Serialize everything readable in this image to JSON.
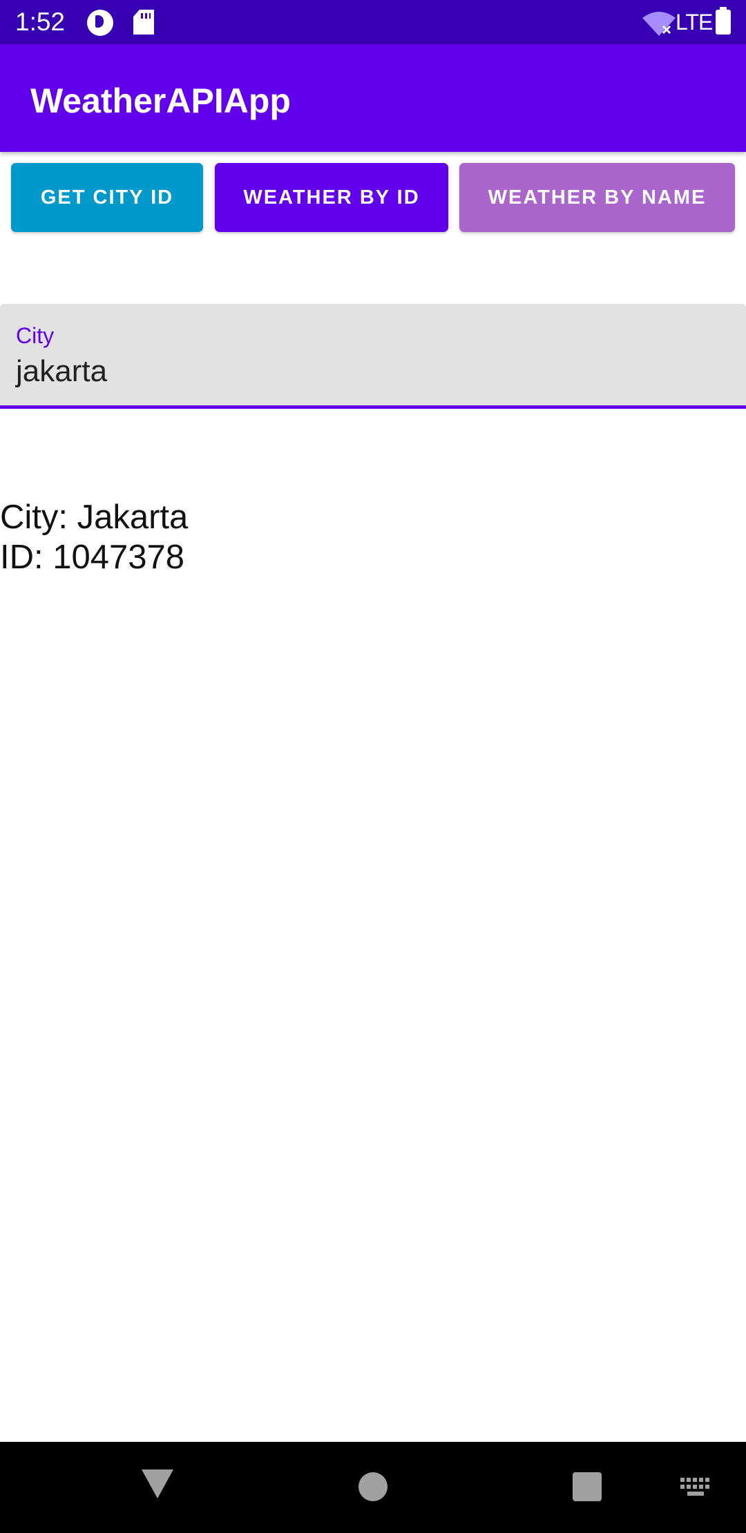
{
  "status_bar": {
    "time": "1:52",
    "network": "LTE",
    "icons": [
      "app-notification-icon",
      "sd-card-icon",
      "wifi-off-icon",
      "battery-icon"
    ]
  },
  "app_bar": {
    "title": "WeatherAPIApp",
    "color": "#6200ee"
  },
  "buttons": {
    "get_city_id": {
      "label": "GET CITY ID",
      "color": "#0099cc"
    },
    "weather_by_id": {
      "label": "WEATHER BY ID",
      "color": "#6200ee"
    },
    "weather_by_name": {
      "label": "WEATHER BY NAME",
      "color": "#aa66cc"
    }
  },
  "city_field": {
    "label": "City",
    "value": "jakarta"
  },
  "result": {
    "city_line": "City: Jakarta",
    "id_line": "ID: 1047378"
  },
  "nav_bar": {
    "icons": [
      "back-icon",
      "home-icon",
      "recents-icon",
      "keyboard-icon"
    ]
  }
}
